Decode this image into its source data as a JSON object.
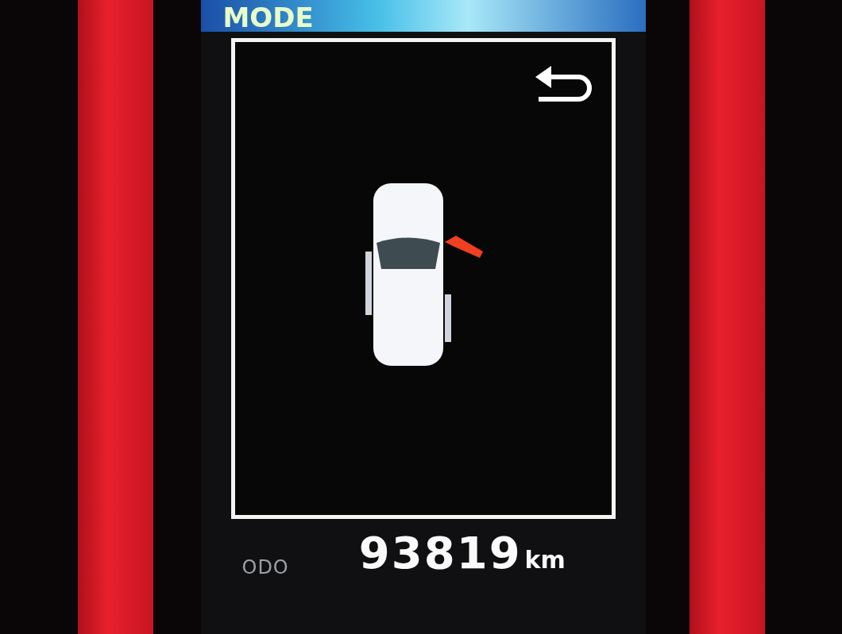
{
  "header": {
    "title": "MODE"
  },
  "vehicle": {
    "front_right_door_open": true
  },
  "odometer": {
    "label": "ODO",
    "value": "93819",
    "unit": "km"
  }
}
